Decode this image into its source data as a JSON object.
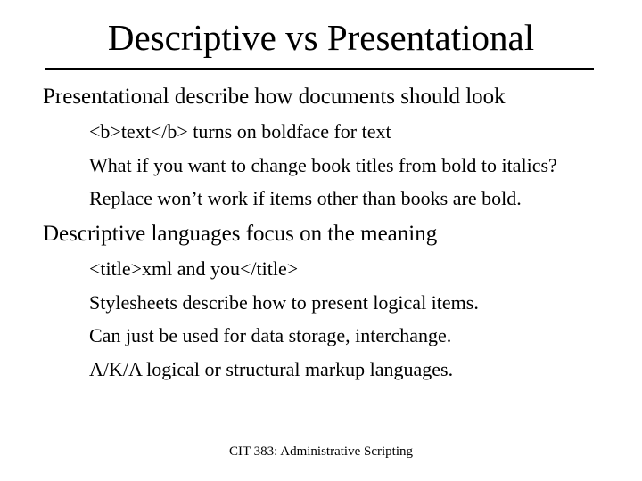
{
  "title": "Descriptive vs Presentational",
  "section1": "Presentational describe how documents should look",
  "bullets1": {
    "b0": "<b>text</b> turns on boldface for text",
    "b1": "What if you want to change book titles from bold to italics?",
    "b2": "Replace won’t work if items other than books are bold."
  },
  "section2": "Descriptive languages focus on the meaning",
  "bullets2": {
    "b0": "<title>xml and you</title>",
    "b1": "Stylesheets describe how to present logical items.",
    "b2": "Can just be used for data storage, interchange.",
    "b3": "A/K/A logical or structural markup languages."
  },
  "footer": "CIT 383: Administrative Scripting"
}
